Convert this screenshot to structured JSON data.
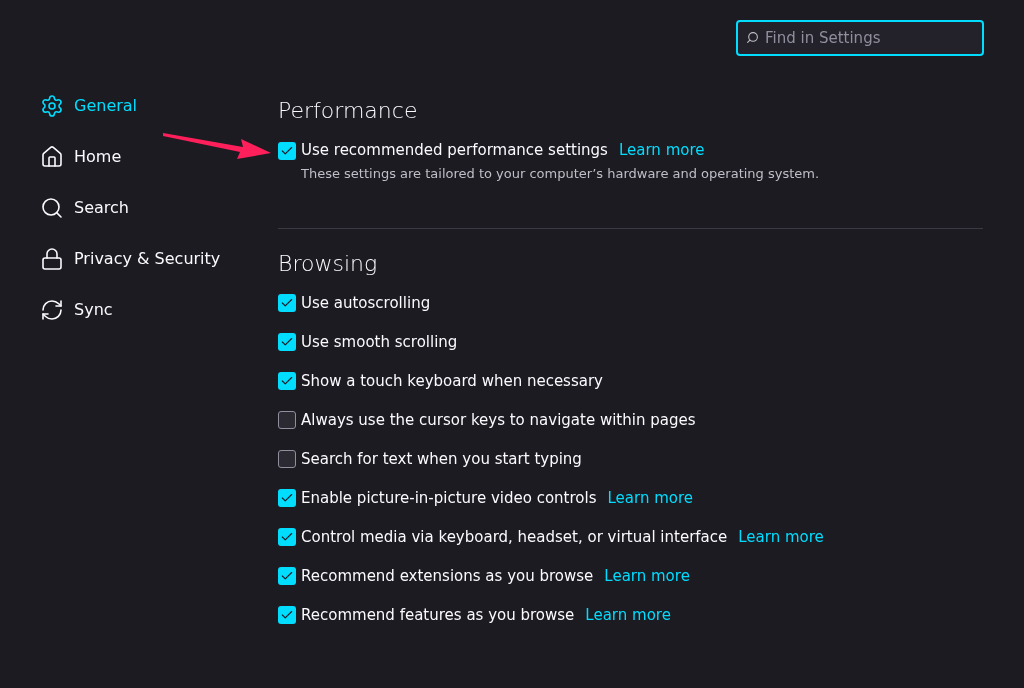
{
  "search": {
    "placeholder": "Find in Settings"
  },
  "sidebar": {
    "items": [
      {
        "label": "General",
        "selected": true
      },
      {
        "label": "Home",
        "selected": false
      },
      {
        "label": "Search",
        "selected": false
      },
      {
        "label": "Privacy & Security",
        "selected": false
      },
      {
        "label": "Sync",
        "selected": false
      }
    ]
  },
  "sections": [
    {
      "title": "Performance",
      "options": [
        {
          "label": "Use recommended performance settings",
          "checked": true,
          "link": "Learn more",
          "description": "These settings are tailored to your computer’s hardware and operating system."
        }
      ]
    },
    {
      "title": "Browsing",
      "options": [
        {
          "label": "Use autoscrolling",
          "checked": true
        },
        {
          "label": "Use smooth scrolling",
          "checked": true
        },
        {
          "label": "Show a touch keyboard when necessary",
          "checked": true
        },
        {
          "label": "Always use the cursor keys to navigate within pages",
          "checked": false
        },
        {
          "label": "Search for text when you start typing",
          "checked": false
        },
        {
          "label": "Enable picture-in-picture video controls",
          "checked": true,
          "link": "Learn more"
        },
        {
          "label": "Control media via keyboard, headset, or virtual interface",
          "checked": true,
          "link": "Learn more"
        },
        {
          "label": "Recommend extensions as you browse",
          "checked": true,
          "link": "Learn more"
        },
        {
          "label": "Recommend features as you browse",
          "checked": true,
          "link": "Learn more"
        }
      ]
    }
  ]
}
